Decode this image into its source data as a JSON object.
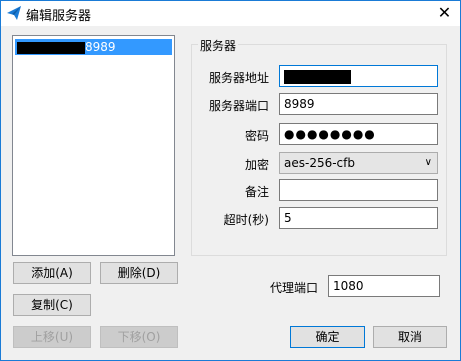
{
  "window": {
    "title": "编辑服务器",
    "close_glyph": "✕",
    "accent": "#1a7bd6"
  },
  "server_list": {
    "items": [
      {
        "label": "8989",
        "redacted_prefix": true,
        "selected": true
      }
    ]
  },
  "left_buttons": {
    "add": "添加(A)",
    "delete": "删除(D)",
    "copy": "复制(C)",
    "move_up": "上移(U)",
    "move_down": "下移(O)"
  },
  "server_group": {
    "title": "服务器",
    "fields": {
      "address": {
        "label": "服务器地址",
        "value": "",
        "redacted": true
      },
      "port": {
        "label": "服务器端口",
        "value": "8989"
      },
      "password": {
        "label": "密码",
        "value": "●●●●●●●●"
      },
      "encryption": {
        "label": "加密",
        "value": "aes-256-cfb"
      },
      "remarks": {
        "label": "备注",
        "value": ""
      },
      "timeout": {
        "label": "超时(秒)",
        "value": "5"
      }
    }
  },
  "proxy_port": {
    "label": "代理端口",
    "value": "1080"
  },
  "dialog_buttons": {
    "ok": "确定",
    "cancel": "取消"
  },
  "icons": {
    "app": "paper-plane-icon",
    "close": "close-icon",
    "dropdown": "chevron-down-icon"
  }
}
